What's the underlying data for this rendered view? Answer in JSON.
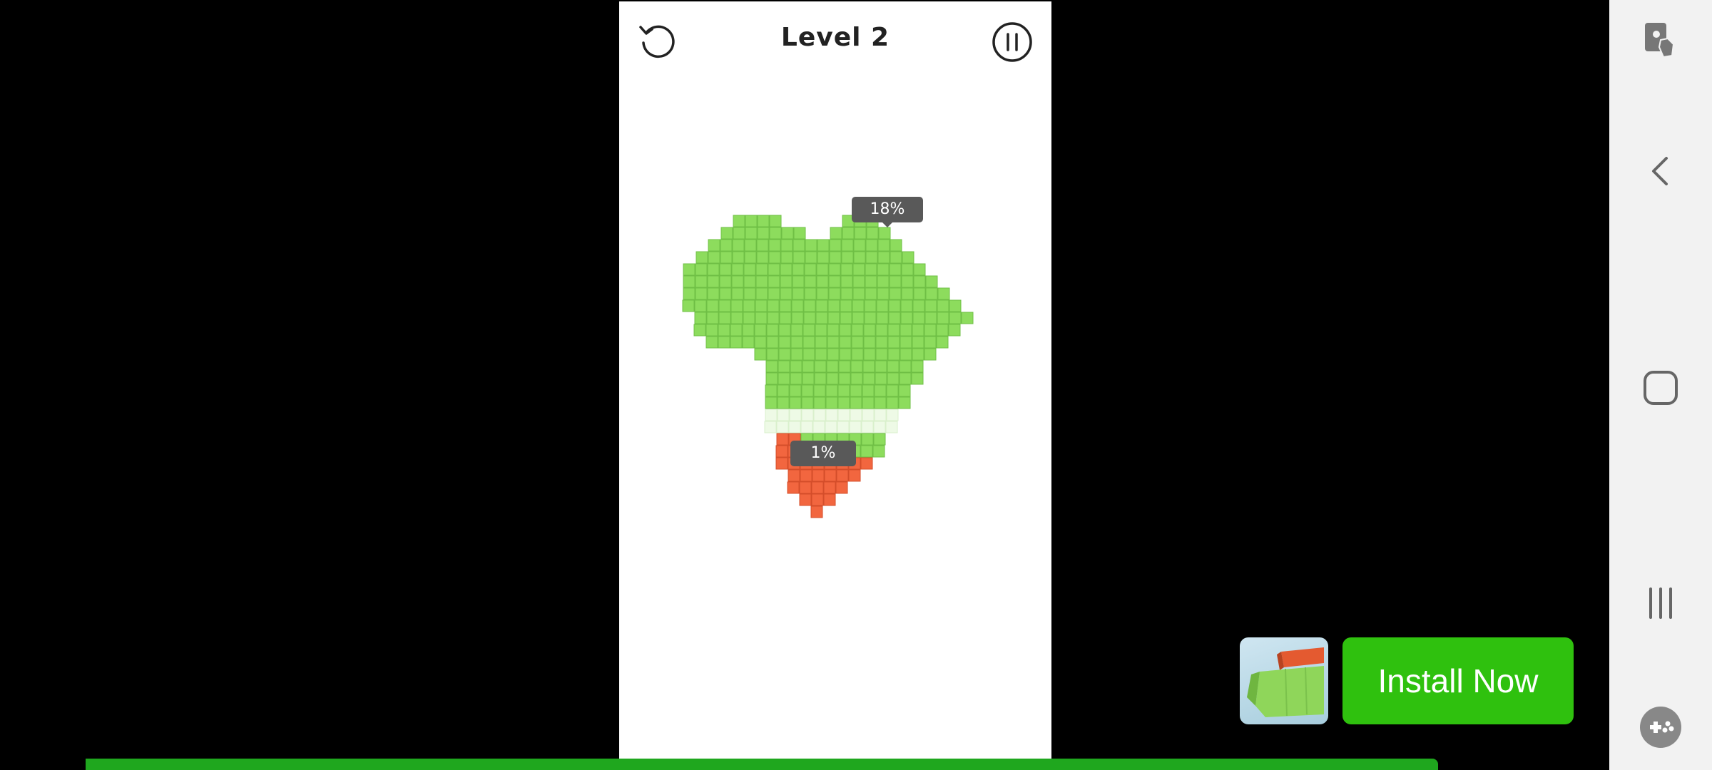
{
  "game": {
    "level_title": "Level 2",
    "restart_icon": "restart-icon",
    "pause_icon": "pause-icon",
    "green_progress": "18%",
    "red_progress": "1%"
  },
  "colors": {
    "green_cube": "#8ddc5d",
    "red_cube": "#f2663f",
    "label_bg": "#595959",
    "install_button": "#2fc10e",
    "progress_bar": "#1fa71e"
  },
  "ad": {
    "install_label": "Install Now",
    "thumbnail_icon": "game-thumbnail"
  },
  "side_nav": {
    "icons": [
      "screen-touch-icon",
      "back-icon",
      "home-icon",
      "recents-icon",
      "game-tools-icon"
    ]
  }
}
